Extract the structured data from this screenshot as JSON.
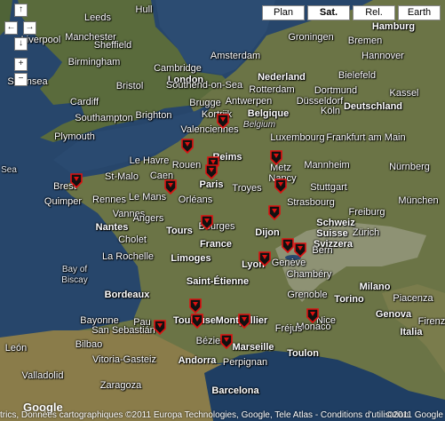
{
  "map_type_buttons": [
    {
      "label": "Plan",
      "active": false
    },
    {
      "label": "Sat.",
      "active": true
    },
    {
      "label": "Rel.",
      "active": false
    },
    {
      "label": "Earth",
      "active": false
    }
  ],
  "nav_controls": {
    "up": "↑",
    "left": "←",
    "right": "→",
    "down": "↓",
    "zoom_in": "+",
    "zoom_out": "−"
  },
  "labels": {
    "hamburg": "Hamburg",
    "manchester": "Manchester",
    "leeds": "Leeds",
    "hull": "Hull",
    "sheffield": "Sheffield",
    "groningen": "Groningen",
    "bremen": "Bremen",
    "liverpool": "Liverpool",
    "amsterdam": "Amsterdam",
    "nederland": "Nederland",
    "hannover": "Hannover",
    "birmingham": "Birmingham",
    "cambridge": "Cambridge",
    "swansea": "Swansea",
    "bristol": "Bristol",
    "london": "London",
    "southend": "Southend-on-Sea",
    "rotterdam": "Rotterdam",
    "bielefeld": "Bielefeld",
    "cardiff": "Cardiff",
    "dortmund": "Dortmund",
    "antwerpen": "Antwerpen",
    "dusseldorf": "Düsseldorf",
    "kassel": "Kassel",
    "southampton": "Southampton",
    "brighton": "Brighton",
    "brugge": "Brugge",
    "koln": "Köln",
    "plymouth": "Plymouth",
    "kortrijk": "Kortrijk",
    "belgique": "Belgique",
    "belgium": "Belgium",
    "deutschland": "Deutschland",
    "valenciennes": "Valenciennes",
    "frankfurt": "Frankfurt am Main",
    "sea": "Sea",
    "luxembourg": "Luxembourg",
    "le_havre": "Le Havre",
    "rouen": "Rouen",
    "reims": "Reims",
    "mannheim": "Mannheim",
    "nurnberg": "Nürnberg",
    "st_malo": "St-Malo",
    "caen": "Caen",
    "metz": "Metz",
    "nancy": "Nancy",
    "paris": "Paris",
    "stuttgart": "Stuttgart",
    "brest": "Brest",
    "quimper": "Quimper",
    "rennes": "Rennes",
    "troyes": "Troyes",
    "strasbourg": "Strasbourg",
    "munchen": "München",
    "le_mans": "Le Mans",
    "vannes": "Vannes",
    "orleans": "Orléans",
    "freiburg": "Freiburg",
    "nantes": "Nantes",
    "angers": "Angers",
    "tours": "Tours",
    "bourges": "Bourges",
    "dijon": "Dijon",
    "schweiz": "Schweiz",
    "suisse": "Suisse",
    "svizzera": "Svizzera",
    "zurich": "Zürich",
    "cholet": "Cholet",
    "france": "France",
    "bern": "Bern",
    "la_rochelle": "La Rochelle",
    "limoges": "Limoges",
    "lyon": "Lyon",
    "geneve": "Genève",
    "bay_of_biscay": "Bay of\nBiscay",
    "chambery": "Chambéry",
    "st_etienne": "Saint-Étienne",
    "milano": "Milano",
    "bordeaux": "Bordeaux",
    "grenoble": "Grenoble",
    "torino": "Torino",
    "piacenza": "Piacenza",
    "genova": "Genova",
    "bayonne": "Bayonne",
    "pau": "Pau",
    "toulouse": "Toulouse",
    "montpellier": "Montpellier",
    "nice": "Nice",
    "monaco": "Monaco",
    "firenze": "Firenze",
    "san_sebastian": "San Sebastián",
    "bilbao": "Bilbao",
    "vitoria": "Vitoria-Gasteiz",
    "beziers": "Béziers",
    "marseille": "Marseille",
    "frejus": "Fréjus",
    "italia": "Italia",
    "leon": "León",
    "andorra": "Andorra",
    "perpignan": "Perpignan",
    "toulon": "Toulon",
    "valladolid": "Valladolid",
    "zaragoza": "Zaragoza",
    "barcelona": "Barcelona",
    "google": "Google"
  },
  "copyright": "trics, Données cartographiques ©2011 Europa Technologies, Google, Tele Atlas - Conditions d'utilisation",
  "copyright_right": "©2011 Google"
}
